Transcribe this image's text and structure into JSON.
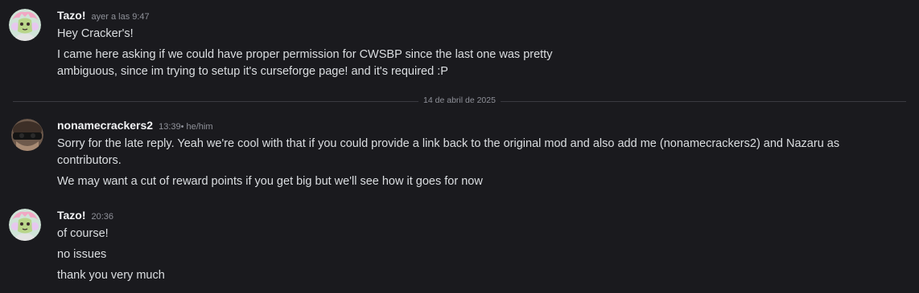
{
  "messages": [
    {
      "author": "Tazo!",
      "timestamp": "ayer a las 9:47",
      "lines": [
        "Hey Cracker's!",
        "I came here asking if we could have proper permission for CWSBP since the last one was pretty",
        "ambiguous, since im trying to setup it's curseforge page! and it's required :P"
      ]
    },
    {
      "author": "nonamecrackers2",
      "timestamp": "13:39",
      "pronouns": " • he/him",
      "lines": [
        "Sorry for the late reply. Yeah we're cool with that if you could provide a link back to the original mod and also add me (nonamecrackers2) and Nazaru as",
        "contributors.",
        "We may want a cut of reward points if you get big but we'll see how it goes for now"
      ]
    },
    {
      "author": "Tazo!",
      "timestamp": "20:36",
      "lines": [
        "of course!",
        "no issues",
        "thank you very much"
      ]
    }
  ],
  "date_divider": "14 de abril de 2025",
  "colors": {
    "background": "#1a1a1e",
    "text": "#dbdee1",
    "username": "#f2f3f5",
    "muted": "#8f9199"
  }
}
